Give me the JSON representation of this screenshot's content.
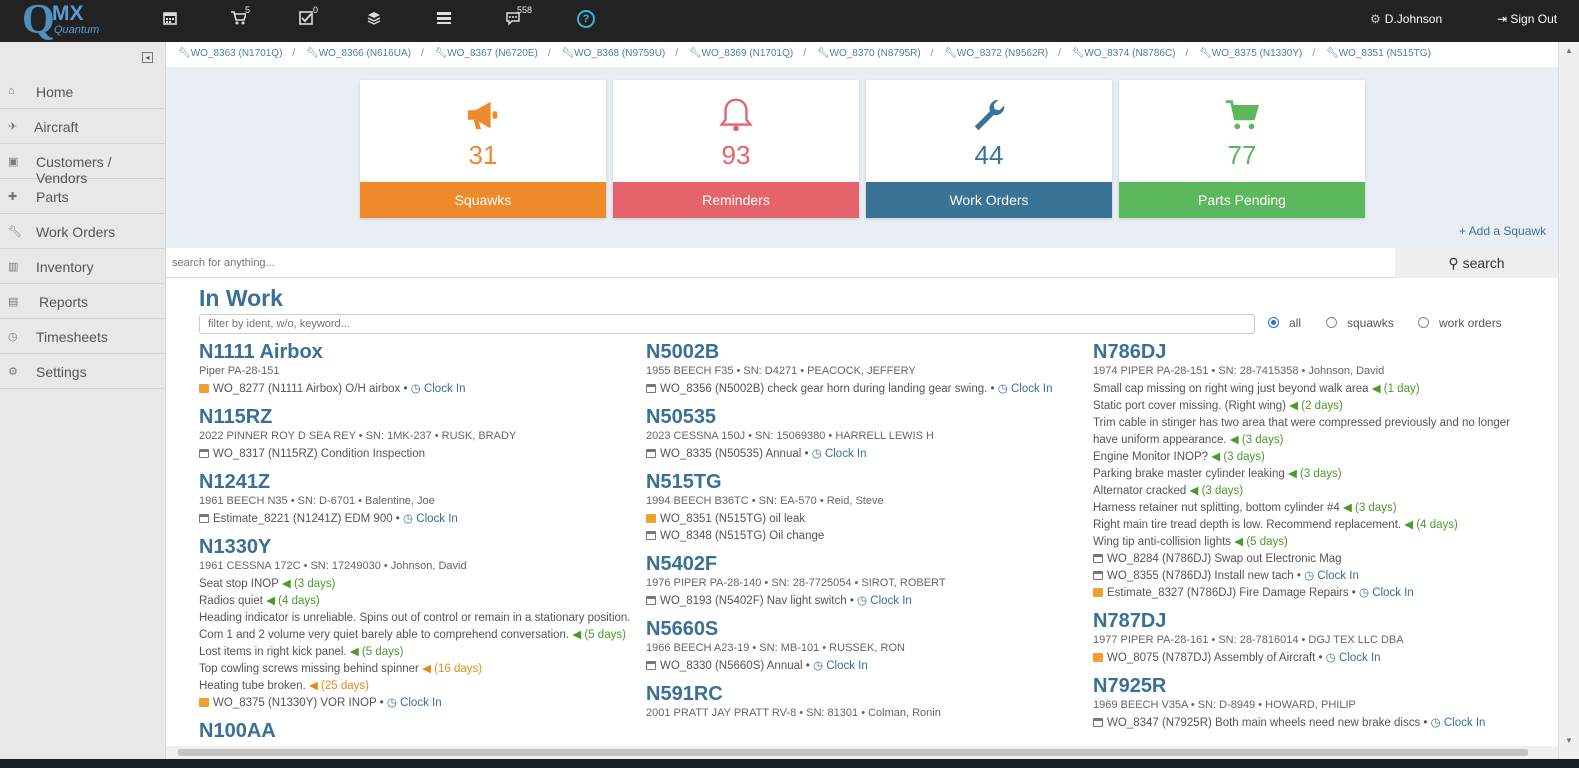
{
  "topbar": {
    "logo": {
      "q": "Q",
      "mx": "MX",
      "quantum": "Quantum"
    },
    "cart_count": "5",
    "tasks_count": "0",
    "messages_count": "558",
    "help": "?",
    "user_name": "D.Johnson",
    "signout_label": "Sign Out"
  },
  "sidebar": {
    "collapse": "◂",
    "items": [
      {
        "label": "Home",
        "icon": "home-icon"
      },
      {
        "label": "Aircraft",
        "icon": "plane-icon"
      },
      {
        "label": "Customers / Vendors",
        "icon": "contacts-icon"
      },
      {
        "label": "Parts",
        "icon": "puzzle-icon"
      },
      {
        "label": "Work Orders",
        "icon": "wrench-icon"
      },
      {
        "label": "Inventory",
        "icon": "barcode-icon"
      },
      {
        "label": "Reports",
        "icon": "bar-chart-icon"
      },
      {
        "label": "Timesheets",
        "icon": "clock-icon"
      },
      {
        "label": "Settings",
        "icon": "gear-icon"
      }
    ]
  },
  "breadcrumb": [
    "WO_8363 (N1701Q)",
    "WO_8366 (N616UA)",
    "WO_8367 (N6720E)",
    "WO_8368 (N9759U)",
    "WO_8369 (N1701Q)",
    "WO_8370 (N8795R)",
    "WO_8372 (N9562R)",
    "WO_8374 (N8786C)",
    "WO_8375 (N1330Y)",
    "WO_8351 (N515TG)"
  ],
  "stats": {
    "squawks": {
      "value": "31",
      "label": "Squawks",
      "color": "#ee8a2a"
    },
    "reminders": {
      "value": "93",
      "label": "Reminders",
      "color": "#e5636b"
    },
    "work_orders": {
      "value": "44",
      "label": "Work Orders",
      "color": "#3a7396"
    },
    "parts_pending": {
      "value": "77",
      "label": "Parts Pending",
      "color": "#5cb85c"
    }
  },
  "add_squawk": "+ Add a Squawk",
  "search": {
    "placeholder": "search for anything...",
    "button": "search"
  },
  "inwork": {
    "title": "In Work",
    "filter_placeholder": "filter by ident, w/o, keyword...",
    "radios": {
      "all": "all",
      "squawks": "squawks",
      "work_orders": "work orders"
    },
    "col1": [
      {
        "tail": "N1111 Airbox",
        "desc": "Piper PA-28-151",
        "lines": [
          {
            "type": "folder",
            "text": "WO_8277 (N1111 Airbox) O/H airbox • ",
            "clock": "Clock In"
          }
        ]
      },
      {
        "tail": "N115RZ",
        "desc": "2022 PINNER ROY D SEA REY • SN: 1MK-237 • RUSK, BRADY",
        "lines": [
          {
            "type": "cal",
            "text": "WO_8317 (N115RZ) Condition Inspection"
          }
        ]
      },
      {
        "tail": "N1241Z",
        "desc": "1961 BEECH N35 • SN: D-6701 • Balentine, Joe",
        "lines": [
          {
            "type": "cal",
            "text": "Estimate_8221 (N1241Z) EDM 900 • ",
            "clock": "Clock In"
          }
        ]
      },
      {
        "tail": "N1330Y",
        "desc": "1961 CESSNA 172C • SN: 17249030 • Johnson, David",
        "lines": [
          {
            "type": "squawk",
            "text": "Seat stop INOP ",
            "days": "(3 days)"
          },
          {
            "type": "squawk",
            "text": "Radios quiet ",
            "days": "(4 days)"
          },
          {
            "type": "squawk",
            "text": "Heading indicator is unreliable. Spins out of control or remain in a stationary position."
          },
          {
            "type": "squawk",
            "text": "Com 1 and 2 volume very quiet barely able to comprehend conversation. ",
            "days": "(5 days)"
          },
          {
            "type": "squawk",
            "text": "Lost items in right kick panel. ",
            "days": "(5 days)"
          },
          {
            "type": "squawk",
            "text": "Top cowling screws missing behind spinner ",
            "days": "(16 days)",
            "late": true
          },
          {
            "type": "squawk",
            "text": "Heating tube broken. ",
            "days": "(25 days)",
            "late": true
          },
          {
            "type": "folder",
            "text": "WO_8375 (N1330Y) VOR INOP • ",
            "clock": "Clock In"
          }
        ]
      },
      {
        "tail": "N100AA",
        "desc": "",
        "lines": []
      }
    ],
    "col2": [
      {
        "tail": "N5002B",
        "desc": "1955 BEECH F35 • SN: D4271 • PEACOCK, JEFFERY",
        "lines": [
          {
            "type": "cal",
            "text": "WO_8356 (N5002B) check gear horn during landing gear swing. • ",
            "clock": "Clock In"
          }
        ]
      },
      {
        "tail": "N50535",
        "desc": "2023 CESSNA 150J • SN: 15069380 • HARRELL LEWIS H",
        "lines": [
          {
            "type": "cal",
            "text": "WO_8335 (N50535) Annual • ",
            "clock": "Clock In"
          }
        ]
      },
      {
        "tail": "N515TG",
        "desc": "1994 BEECH B36TC • SN: EA-570 • Reid, Steve",
        "lines": [
          {
            "type": "folder",
            "text": "WO_8351 (N515TG) oil leak"
          },
          {
            "type": "cal",
            "text": "WO_8348 (N515TG) Oil change"
          }
        ]
      },
      {
        "tail": "N5402F",
        "desc": "1976 PIPER PA-28-140 • SN: 28-7725054 • SIROT, ROBERT",
        "lines": [
          {
            "type": "cal",
            "text": "WO_8193 (N5402F) Nav light switch • ",
            "clock": "Clock In"
          }
        ]
      },
      {
        "tail": "N5660S",
        "desc": "1966 BEECH A23-19 • SN: MB-101 • RUSSEK, RON",
        "lines": [
          {
            "type": "cal",
            "text": "WO_8330 (N5660S) Annual • ",
            "clock": "Clock In"
          }
        ]
      },
      {
        "tail": "N591RC",
        "desc": "2001 PRATT JAY PRATT RV-8 • SN: 81301 • Colman, Ronin",
        "lines": []
      }
    ],
    "col3": [
      {
        "tail": "N786DJ",
        "desc": "1974 PIPER PA-28-151 • SN: 28-7415358 • Johnson, David",
        "lines": [
          {
            "type": "squawk",
            "text": "Small cap missing on right wing just beyond walk area ",
            "days": "(1 day)"
          },
          {
            "type": "squawk",
            "text": "Static port cover missing. (Right wing) ",
            "days": "(2 days)"
          },
          {
            "type": "squawk",
            "text": "Trim cable in stinger has two area that were compressed previously and no longer have uniform appearance. ",
            "days": "(3 days)"
          },
          {
            "type": "squawk",
            "text": "Engine Monitor INOP? ",
            "days": "(3 days)"
          },
          {
            "type": "squawk",
            "text": "Parking brake master cylinder leaking ",
            "days": "(3 days)"
          },
          {
            "type": "squawk",
            "text": "Alternator cracked ",
            "days": "(3 days)"
          },
          {
            "type": "squawk",
            "text": "Harness retainer nut splitting, bottom cylinder #4 ",
            "days": "(3 days)"
          },
          {
            "type": "squawk",
            "text": "Right main tire tread depth is low. Recommend replacement. ",
            "days": "(4 days)"
          },
          {
            "type": "squawk",
            "text": "Wing tip anti-collision lights ",
            "days": "(5 days)"
          },
          {
            "type": "cal",
            "text": "WO_8284 (N786DJ) Swap out Electronic Mag"
          },
          {
            "type": "cal",
            "text": "WO_8355 (N786DJ) Install new tach • ",
            "clock": "Clock In"
          },
          {
            "type": "folder",
            "text": "Estimate_8327 (N786DJ) Fire Damage Repairs • ",
            "clock": "Clock In"
          }
        ]
      },
      {
        "tail": "N787DJ",
        "desc": "1977 PIPER PA-28-161 • SN: 28-7816014 • DGJ TEX LLC DBA",
        "lines": [
          {
            "type": "folder",
            "text": "WO_8075 (N787DJ) Assembly of Aircraft • ",
            "clock": "Clock In"
          }
        ]
      },
      {
        "tail": "N7925R",
        "desc": "1969 BEECH V35A • SN: D-8949 • HOWARD, PHILIP",
        "lines": [
          {
            "type": "cal",
            "text": "WO_8347 (N7925R) Both main wheels need new brake discs • ",
            "clock": "Clock In"
          }
        ]
      }
    ]
  }
}
